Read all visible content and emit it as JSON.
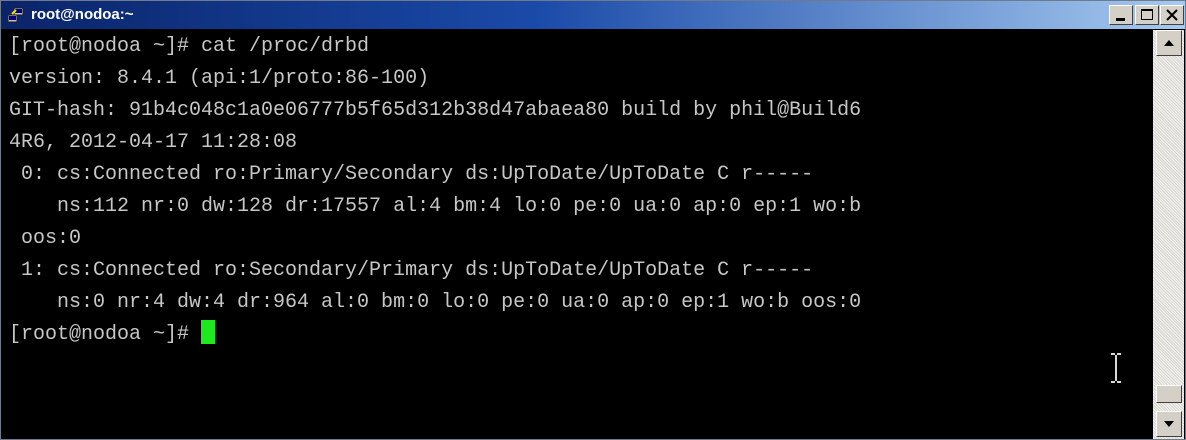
{
  "window": {
    "title": "root@nodoa:~"
  },
  "terminal": {
    "lines": [
      "[root@nodoa ~]# cat /proc/drbd",
      "version: 8.4.1 (api:1/proto:86-100)",
      "GIT-hash: 91b4c048c1a0e06777b5f65d312b38d47abaea80 build by phil@Build6",
      "4R6, 2012-04-17 11:28:08",
      " 0: cs:Connected ro:Primary/Secondary ds:UpToDate/UpToDate C r-----",
      "    ns:112 nr:0 dw:128 dr:17557 al:4 bm:4 lo:0 pe:0 ua:0 ap:0 ep:1 wo:b",
      " oos:0",
      " 1: cs:Connected ro:Secondary/Primary ds:UpToDate/UpToDate C r-----",
      "    ns:0 nr:4 dw:4 dr:964 al:0 bm:0 lo:0 pe:0 ua:0 ap:0 ep:1 wo:b oos:0"
    ],
    "prompt": "[root@nodoa ~]# "
  },
  "icons": {
    "app": "putty-icon",
    "minimize": "minimize-icon",
    "maximize": "maximize-icon",
    "close": "close-icon",
    "scroll_up": "arrow-up-icon",
    "scroll_down": "arrow-down-icon",
    "text_cursor": "ibeam-cursor-icon"
  },
  "colors": {
    "terminal_bg": "#000000",
    "terminal_fg": "#c6c6c6",
    "cursor": "#1ee81e",
    "titlebar_start": "#0a246a",
    "titlebar_end": "#a6caf0"
  }
}
